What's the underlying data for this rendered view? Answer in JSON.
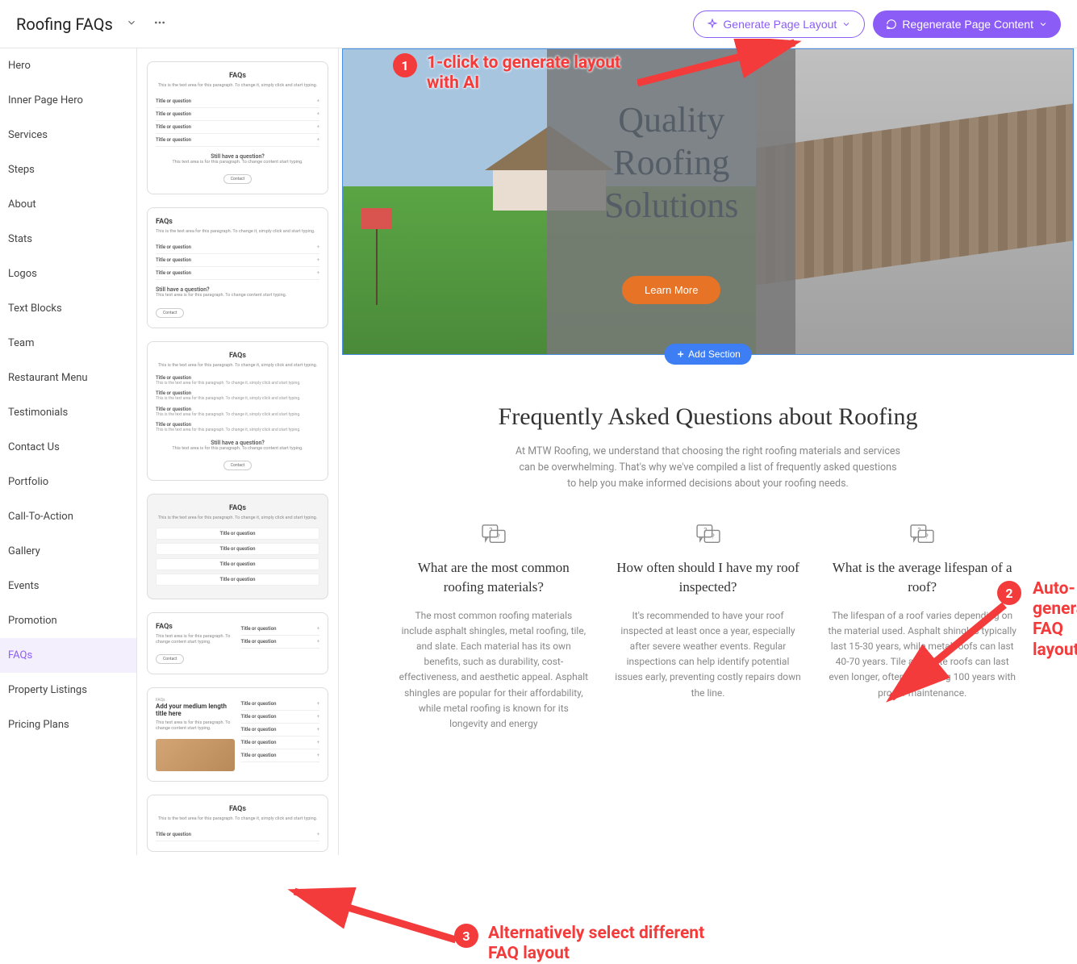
{
  "topbar": {
    "title": "Roofing FAQs",
    "generate_label": "Generate Page Layout",
    "regenerate_label": "Regenerate Page Content"
  },
  "sidebar1": {
    "items": [
      {
        "label": "Hero"
      },
      {
        "label": "Inner Page Hero"
      },
      {
        "label": "Services"
      },
      {
        "label": "Steps"
      },
      {
        "label": "About"
      },
      {
        "label": "Stats"
      },
      {
        "label": "Logos"
      },
      {
        "label": "Text Blocks"
      },
      {
        "label": "Team"
      },
      {
        "label": "Restaurant Menu"
      },
      {
        "label": "Testimonials"
      },
      {
        "label": "Contact Us"
      },
      {
        "label": "Portfolio"
      },
      {
        "label": "Call-To-Action"
      },
      {
        "label": "Gallery"
      },
      {
        "label": "Events"
      },
      {
        "label": "Promotion"
      },
      {
        "label": "FAQs",
        "active": true
      },
      {
        "label": "Property Listings"
      },
      {
        "label": "Pricing Plans"
      }
    ]
  },
  "templates": {
    "faq_title": "FAQs",
    "faq_sub_long": "This is the text area for this paragraph. To change it, simply click and start typing.",
    "faq_sub_short": "This text area is for this paragraph. To change content start typing.",
    "row_label": "Title or question",
    "still_q": "Still have a question?",
    "contact": "Contact",
    "medium_title": "Add your medium length title here"
  },
  "hero": {
    "title_l1": "Quality",
    "title_l2": "Roofing",
    "title_l3": "Solutions",
    "button": "Learn More",
    "add_section": "Add Section"
  },
  "faq": {
    "heading": "Frequently Asked Questions about Roofing",
    "sub": "At MTW Roofing, we understand that choosing the right roofing materials and services can be overwhelming. That's why we've compiled a list of frequently asked questions to help you make informed decisions about your roofing needs.",
    "items": [
      {
        "q": "What are the most common roofing materials?",
        "a": "The most common roofing materials include asphalt shingles, metal roofing, tile, and slate. Each material has its own benefits, such as durability, cost-effectiveness, and aesthetic appeal. Asphalt shingles are popular for their affordability, while metal roofing is known for its longevity and energy"
      },
      {
        "q": "How often should I have my roof inspected?",
        "a": "It's recommended to have your roof inspected at least once a year, especially after severe weather events. Regular inspections can help identify potential issues early, preventing costly repairs down the line."
      },
      {
        "q": "What is the average lifespan of a roof?",
        "a": "The lifespan of a roof varies depending on the material used. Asphalt shingles typically last 15-30 years, while metal roofs can last 40-70 years. Tile and slate roofs can last even longer, often exceeding 100 years with proper maintenance."
      }
    ]
  },
  "annotations": {
    "a1": "1-click to generate layout with AI",
    "a2": "Auto-generated FAQ layout",
    "a3": "Alternatively select different FAQ layout",
    "n1": "1",
    "n2": "2",
    "n3": "3"
  }
}
